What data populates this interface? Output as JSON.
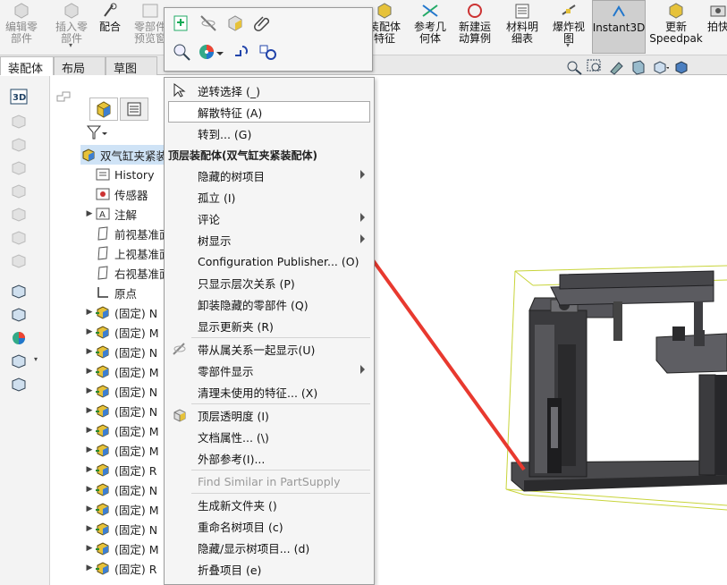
{
  "ribbon": {
    "buttons": [
      {
        "label": "编辑零\n部件",
        "dim": true
      },
      {
        "label": "插入零\n部件",
        "dim": true
      },
      {
        "label": "配合",
        "dim": false
      },
      {
        "label": "零部件\n预览窗",
        "dim": true
      },
      {
        "label": "装配体\n特征",
        "dim": false
      },
      {
        "label": "参考几\n何体",
        "dim": false
      },
      {
        "label": "新建运\n动算例",
        "dim": false
      },
      {
        "label": "材料明\n细表",
        "dim": false
      },
      {
        "label": "爆炸视\n图",
        "dim": false
      },
      {
        "label": "Instant3D",
        "dim": false,
        "active": true
      },
      {
        "label": "更新\nSpeedpak",
        "dim": false
      },
      {
        "label": "拍快",
        "dim": false
      }
    ]
  },
  "command_tabs": [
    "装配体",
    "布局",
    "草图"
  ],
  "feature_tree": {
    "root": "双气缸夹紧装配体",
    "items": [
      {
        "label": "History",
        "icon": "history-icon",
        "expandable": false
      },
      {
        "label": "传感器",
        "icon": "sensor-icon",
        "expandable": false
      },
      {
        "label": "注解",
        "icon": "annotation-icon",
        "expandable": true
      },
      {
        "label": "前视基准面",
        "icon": "plane-icon",
        "expandable": false
      },
      {
        "label": "上视基准面",
        "icon": "plane-icon",
        "expandable": false
      },
      {
        "label": "右视基准面",
        "icon": "plane-icon",
        "expandable": false
      },
      {
        "label": "原点",
        "icon": "origin-icon",
        "expandable": false
      },
      {
        "label": "(固定) N",
        "icon": "part-icon",
        "expandable": true
      },
      {
        "label": "(固定) M",
        "icon": "part-icon",
        "expandable": true
      },
      {
        "label": "(固定) N",
        "icon": "part-icon",
        "expandable": true
      },
      {
        "label": "(固定) M",
        "icon": "part-icon",
        "expandable": true
      },
      {
        "label": "(固定) N",
        "icon": "part-icon",
        "expandable": true
      },
      {
        "label": "(固定) N",
        "icon": "part-icon",
        "expandable": true
      },
      {
        "label": "(固定) M",
        "icon": "part-icon",
        "expandable": true
      },
      {
        "label": "(固定) M",
        "icon": "part-icon",
        "expandable": true
      },
      {
        "label": "(固定) R",
        "icon": "part-icon",
        "expandable": true
      },
      {
        "label": "(固定) N",
        "icon": "part-icon",
        "expandable": true
      },
      {
        "label": "(固定) M",
        "icon": "part-icon",
        "expandable": true
      },
      {
        "label": "(固定) N",
        "icon": "part-icon",
        "expandable": true
      },
      {
        "label": "(固定) M",
        "icon": "part-icon",
        "expandable": true
      },
      {
        "label": "(固定) R",
        "icon": "part-icon",
        "expandable": true
      }
    ]
  },
  "context_menu": {
    "top_items": [
      {
        "label": "逆转选择 (_)",
        "icon": "pointer-icon"
      },
      {
        "label": "解散特征 (A)",
        "hover": true
      },
      {
        "label": "转到... (G)"
      }
    ],
    "header": "顶层装配体(双气缸夹紧装配体)",
    "groups": [
      [
        {
          "label": "隐藏的树项目",
          "submenu": true
        },
        {
          "label": "孤立 (I)"
        },
        {
          "label": "评论",
          "submenu": true
        },
        {
          "label": "树显示",
          "submenu": true
        },
        {
          "label": "Configuration Publisher... (O)"
        },
        {
          "label": "只显示层次关系 (P)"
        },
        {
          "label": "卸装隐藏的零部件 (Q)"
        },
        {
          "label": "显示更新夹 (R)"
        }
      ],
      [
        {
          "label": "带从属关系一起显示(U)",
          "icon": "dependency-icon"
        },
        {
          "label": "零部件显示",
          "submenu": true
        },
        {
          "label": "清理未使用的特征... (X)"
        }
      ],
      [
        {
          "label": "顶层透明度 (I)",
          "icon": "transparency-icon"
        },
        {
          "label": "文档属性... (\\)"
        },
        {
          "label": "外部参考(I)..."
        }
      ],
      [
        {
          "label": "Find Similar in PartSupply",
          "disabled": true
        }
      ],
      [
        {
          "label": "生成新文件夹 ()"
        },
        {
          "label": "重命名树项目 (c)"
        },
        {
          "label": "隐藏/显示树项目... (d)"
        },
        {
          "label": "折叠项目 (e)"
        }
      ]
    ]
  },
  "colors": {
    "arrow": "#e8392f",
    "bbox": "#c8d43a",
    "model_dark": "#3b3b3d",
    "model_mid": "#5a5a5d"
  }
}
